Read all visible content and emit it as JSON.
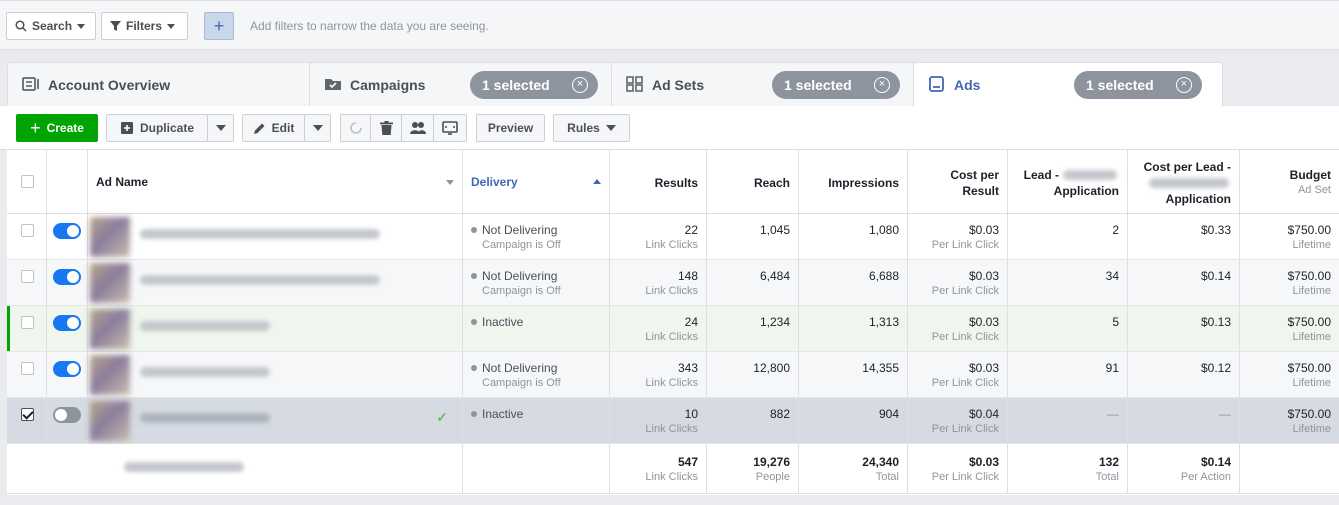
{
  "filterbar": {
    "search_label": "Search",
    "filters_label": "Filters",
    "add_label": "+",
    "hint": "Add filters to narrow the data you are seeing."
  },
  "tabs": [
    {
      "label": "Account Overview",
      "icon": "account-overview-icon"
    },
    {
      "label": "Campaigns",
      "icon": "folder-check-icon",
      "pill": "1 selected"
    },
    {
      "label": "Ad Sets",
      "icon": "grid-icon",
      "pill": "1 selected"
    },
    {
      "label": "Ads",
      "icon": "ad-icon",
      "pill": "1 selected",
      "active": true
    }
  ],
  "toolbar": {
    "create_label": "Create",
    "duplicate_label": "Duplicate",
    "edit_label": "Edit",
    "preview_label": "Preview",
    "rules_label": "Rules"
  },
  "colors": {
    "create_green": "#00a400",
    "toggle_on": "#1877f2",
    "pill_gray": "#8d949e",
    "active_tab_text": "#4267b2"
  },
  "columns": {
    "ad_name": "Ad Name",
    "delivery": "Delivery",
    "results": "Results",
    "reach": "Reach",
    "impressions": "Impressions",
    "cost_per_result_1": "Cost per",
    "cost_per_result_2": "Result",
    "lead_1": "Lead -",
    "lead_2": "Application",
    "cpl_1": "Cost per Lead -",
    "cpl_2": "Application",
    "budget": "Budget",
    "budget_sub": "Ad Set"
  },
  "rows": [
    {
      "status": "Not Delivering",
      "status_sub": "Campaign is Off",
      "results": "22",
      "results_sub": "Link Clicks",
      "reach": "1,045",
      "impressions": "1,080",
      "cpr": "$0.03",
      "cpr_sub": "Per Link Click",
      "leads": "2",
      "cpl": "$0.33",
      "budget": "$750.00",
      "budget_sub": "Lifetime"
    },
    {
      "status": "Not Delivering",
      "status_sub": "Campaign is Off",
      "results": "148",
      "results_sub": "Link Clicks",
      "reach": "6,484",
      "impressions": "6,688",
      "cpr": "$0.03",
      "cpr_sub": "Per Link Click",
      "leads": "34",
      "cpl": "$0.14",
      "budget": "$750.00",
      "budget_sub": "Lifetime"
    },
    {
      "status": "Inactive",
      "status_sub": "",
      "results": "24",
      "results_sub": "Link Clicks",
      "reach": "1,234",
      "impressions": "1,313",
      "cpr": "$0.03",
      "cpr_sub": "Per Link Click",
      "leads": "5",
      "cpl": "$0.13",
      "budget": "$750.00",
      "budget_sub": "Lifetime"
    },
    {
      "status": "Not Delivering",
      "status_sub": "Campaign is Off",
      "results": "343",
      "results_sub": "Link Clicks",
      "reach": "12,800",
      "impressions": "14,355",
      "cpr": "$0.03",
      "cpr_sub": "Per Link Click",
      "leads": "91",
      "cpl": "$0.12",
      "budget": "$750.00",
      "budget_sub": "Lifetime"
    },
    {
      "status": "Inactive",
      "status_sub": "",
      "results": "10",
      "results_sub": "Link Clicks",
      "reach": "882",
      "impressions": "904",
      "cpr": "$0.04",
      "cpr_sub": "Per Link Click",
      "leads": "—",
      "cpl": "—",
      "budget": "$750.00",
      "budget_sub": "Lifetime"
    }
  ],
  "totals": {
    "results": "547",
    "results_sub": "Link Clicks",
    "reach": "19,276",
    "reach_sub": "People",
    "impressions": "24,340",
    "impressions_sub": "Total",
    "cpr": "$0.03",
    "cpr_sub": "Per Link Click",
    "leads": "132",
    "leads_sub": "Total",
    "cpl": "$0.14",
    "cpl_sub": "Per Action"
  }
}
